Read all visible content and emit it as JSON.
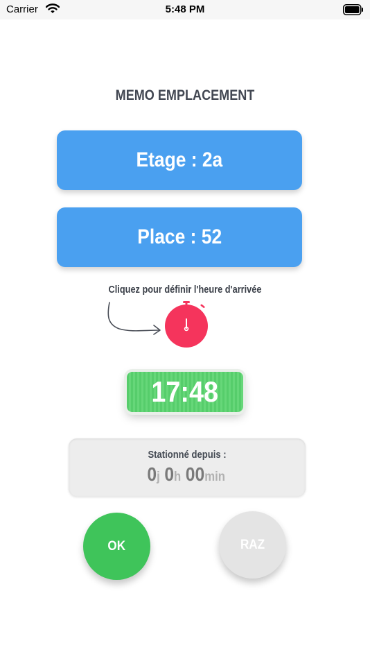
{
  "status_bar": {
    "carrier": "Carrier",
    "time": "5:48 PM"
  },
  "title": "MEMO EMPLACEMENT",
  "floor": {
    "label": "Etage : 2a"
  },
  "place": {
    "label": "Place : 52"
  },
  "hint": "Cliquez pour définir l'heure d'arrivée",
  "arrival_time": "17:48",
  "elapsed": {
    "label": "Stationné depuis :",
    "days": "0",
    "days_unit": "j",
    "hours": "0",
    "hours_unit": "h",
    "minutes": "00",
    "minutes_unit": "min"
  },
  "buttons": {
    "ok": "OK",
    "raz": "RAZ"
  },
  "icons": {
    "wifi": "wifi-icon",
    "battery": "battery-icon",
    "timer": "stopwatch-icon",
    "arrow": "curved-arrow-icon"
  },
  "colors": {
    "primary_blue": "#4aa0f0",
    "timer_red": "#f5345c",
    "ok_green": "#3fc45a",
    "time_green": "#5bd06f",
    "raz_gray": "#e4e4e4"
  }
}
